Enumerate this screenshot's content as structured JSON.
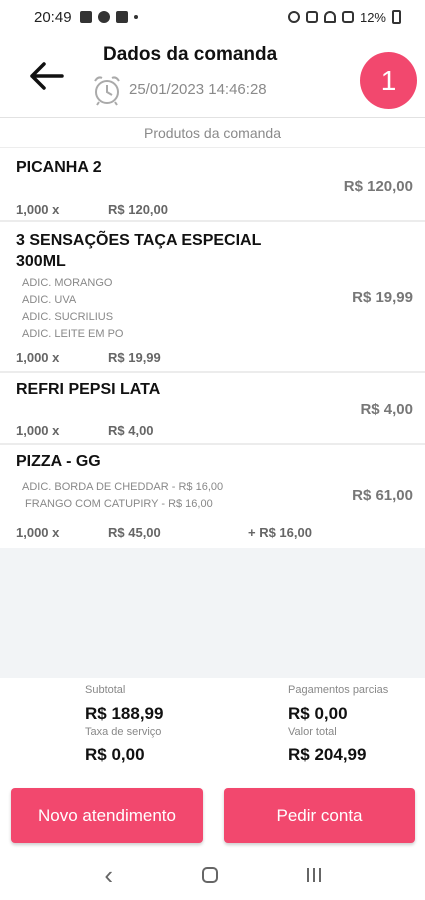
{
  "statusbar": {
    "time": "20:49",
    "battery": "12%"
  },
  "header": {
    "title": "Dados da comanda",
    "datetime": "25/01/2023 14:46:28",
    "badge": "1"
  },
  "section_label": "Produtos da comanda",
  "items": [
    {
      "name": "PICANHA 2",
      "price": "R$ 120,00",
      "additions": [],
      "qty": "1,000 x",
      "unit": "R$ 120,00",
      "extra": ""
    },
    {
      "name": "3 SENSAÇÕES TAÇA ESPECIAL\n300ML",
      "price": "R$ 19,99",
      "additions": [
        "ADIC. MORANGO",
        "ADIC. UVA",
        "ADIC. SUCRILIUS",
        "ADIC. LEITE EM PO"
      ],
      "qty": "1,000 x",
      "unit": "R$ 19,99",
      "extra": ""
    },
    {
      "name": "REFRI PEPSI LATA",
      "price": "R$ 4,00",
      "additions": [],
      "qty": "1,000 x",
      "unit": "R$ 4,00",
      "extra": ""
    },
    {
      "name": "PIZZA - GG",
      "price": "R$ 61,00",
      "additions": [
        "ADIC. BORDA DE CHEDDAR - R$ 16,00",
        " FRANGO COM CATUPIRY - R$ 16,00"
      ],
      "qty": "1,000 x",
      "unit": "R$ 45,00",
      "extra": "+ R$ 16,00"
    }
  ],
  "summary": {
    "subtotal_label": "Subtotal",
    "subtotal_value": "R$ 188,99",
    "partial_label": "Pagamentos parcias",
    "partial_value": "R$ 0,00",
    "service_label": "Taxa de serviço",
    "service_value": "R$ 0,00",
    "total_label": "Valor total",
    "total_value": "R$ 204,99"
  },
  "buttons": {
    "new_service": "Novo atendimento",
    "request_bill": "Pedir conta"
  },
  "colors": {
    "accent": "#f2486e"
  }
}
